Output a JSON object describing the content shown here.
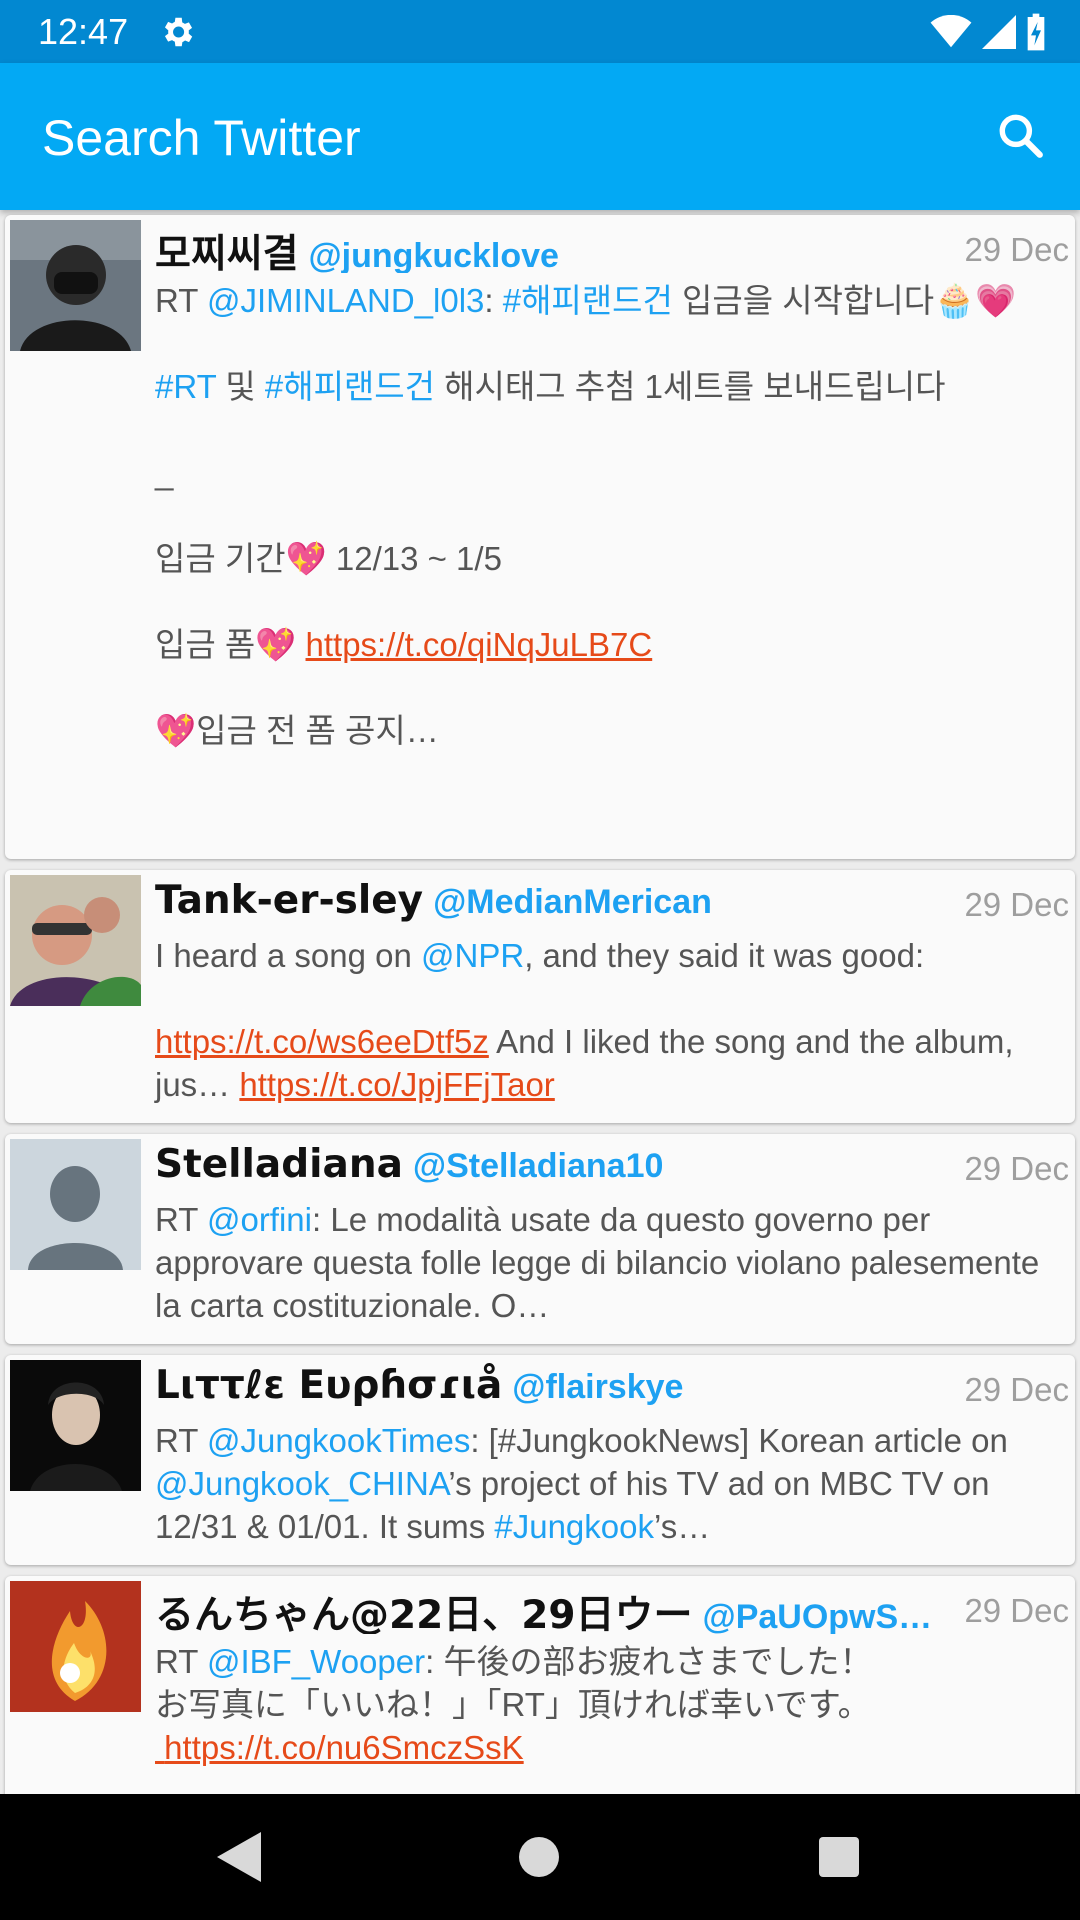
{
  "status_bar": {
    "time": "12:47"
  },
  "app_bar": {
    "title": "Search Twitter"
  },
  "colors": {
    "status_bar": "#0288d1",
    "app_bar": "#03a9f4",
    "mention": "#1da1f2",
    "link": "#e64a19"
  },
  "tweets": [
    {
      "name": "모찌씨결",
      "handle": "@jungkucklove",
      "date": "29 Dec",
      "avatar": "user-photo",
      "t": {
        "rt": "RT ",
        "m1": "@JIMINLAND_l0l3",
        "c1": ": ",
        "h1": "#해피랜드건",
        "t1": " 입금을 시작합니다🧁💗",
        "h2": "#RT",
        "t2": " 및 ",
        "h3": "#해피랜드건",
        "t3": " 해시태그 추첨 1세트를 보내드립니다",
        "t4": "_",
        "t5": "입금 기간💖 12/13 ~ 1/5",
        "t6": "입금 폼💖 ",
        "u1": "https://t.co/qiNqJuLB7C",
        "t7": "💖입금 전 폼 공지…"
      }
    },
    {
      "name": "Tank-er-sley",
      "handle": "@MedianMerican",
      "date": "29 Dec",
      "avatar": "user-photo",
      "t": {
        "t1": "I heard a song on ",
        "m1": "@NPR",
        "t2": ", and they said it was good:",
        "u1": "https://t.co/ws6eeDtf5z",
        "t3": " And I liked the song and the album, jus… ",
        "u2": "https://t.co/JpjFFjTaor"
      }
    },
    {
      "name": "Stelladiana",
      "handle": "@Stelladiana10",
      "date": "29 Dec",
      "avatar": "default-profile",
      "t": {
        "rt": "RT ",
        "m1": "@orfini",
        "t1": ": Le modalità usate da questo governo per approvare questa folle legge di bilancio violano palesemente la carta costituzionale. O…"
      }
    },
    {
      "name": "Lιττℓε Eυρɦσɾιå",
      "handle": "@flairskye",
      "date": "29 Dec",
      "avatar": "user-photo",
      "t": {
        "rt": "RT ",
        "m1": "@JungkookTimes",
        "t1": ": [#JungkookNews] Korean article on ",
        "m2": "@Jungkook_CHINA",
        "t2": "’s project of his TV ad on MBC TV on 12/31 & 01/01. It sums ",
        "h1": "#Jungkook",
        "t3": "’s…"
      }
    },
    {
      "name": "るんちゃん@22日、29日ウー",
      "handle": "@PaUOpwS…",
      "date": "29 Dec",
      "avatar": "user-photo",
      "t": {
        "rt": "RT ",
        "m1": "@IBF_Wooper",
        "t1": ": 午後の部お疲れさまでした！",
        "t2": "お写真に「いいね！」「RT」頂ければ幸いです。",
        "u1": " https://t.co/nu6SmczSsK"
      }
    }
  ]
}
